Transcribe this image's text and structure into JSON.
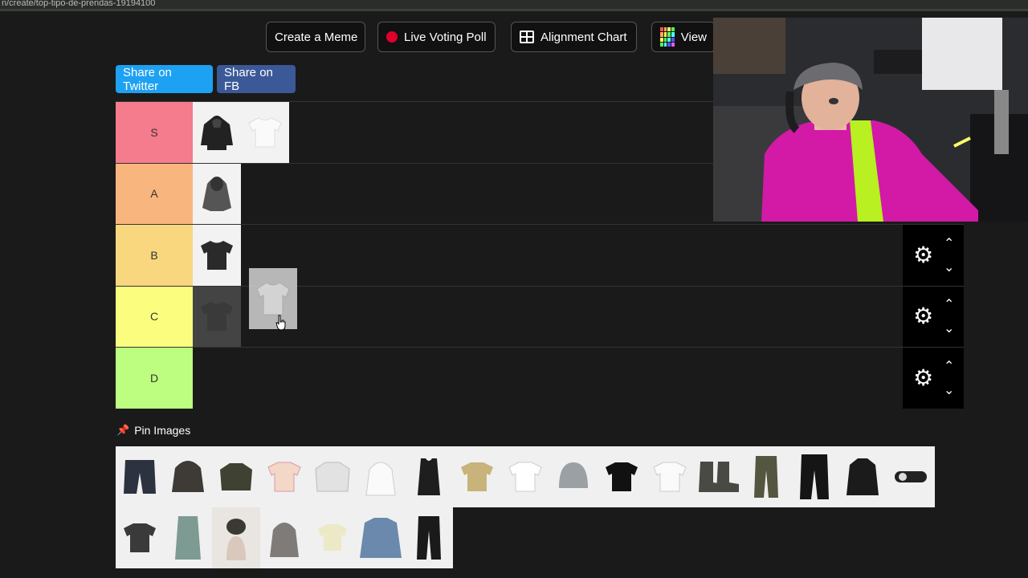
{
  "browser": {
    "url_fragment": "n/create/top-tipo-de-prendas-19194100"
  },
  "top_buttons": {
    "create_meme": "Create a Meme",
    "live_poll": "Live Voting Poll",
    "alignment": "Alignment Chart",
    "view": "View"
  },
  "share": {
    "twitter": "Share on Twitter",
    "fb": "Share on FB"
  },
  "tiers": [
    {
      "label": "S",
      "color": "#f47c8c",
      "items": [
        "black-hoodie",
        "white-tee"
      ]
    },
    {
      "label": "A",
      "color": "#f8b67e",
      "items": [
        "grey-hoodie"
      ]
    },
    {
      "label": "B",
      "color": "#f8d77e",
      "items": [
        "black-tee"
      ]
    },
    {
      "label": "C",
      "color": "#fbfd7f",
      "items": [
        "dark-item"
      ]
    },
    {
      "label": "D",
      "color": "#bdfd7f",
      "items": []
    }
  ],
  "pin_label": "Pin Images",
  "pool": {
    "row1": [
      "jorts",
      "bomber-jacket",
      "camo-sweater",
      "pink-jersey",
      "grey-sweatshirt",
      "white-zip-hoodie",
      "black-tank",
      "gold-polo",
      "white-tee-2",
      "grey-beanie",
      "black-tee-2",
      "white-graphic-tee",
      "boots",
      "camo-pants",
      "black-cargo",
      "black-zip-jacket",
      "belt"
    ],
    "row2": [
      "graphic-tee",
      "denim-skirt",
      "cap-person",
      "grey-hoodie-2",
      "cream-tee",
      "denim-jacket",
      "black-jeans"
    ]
  },
  "colors": {
    "twitter": "#1da1f2",
    "fb": "#3b5998"
  }
}
